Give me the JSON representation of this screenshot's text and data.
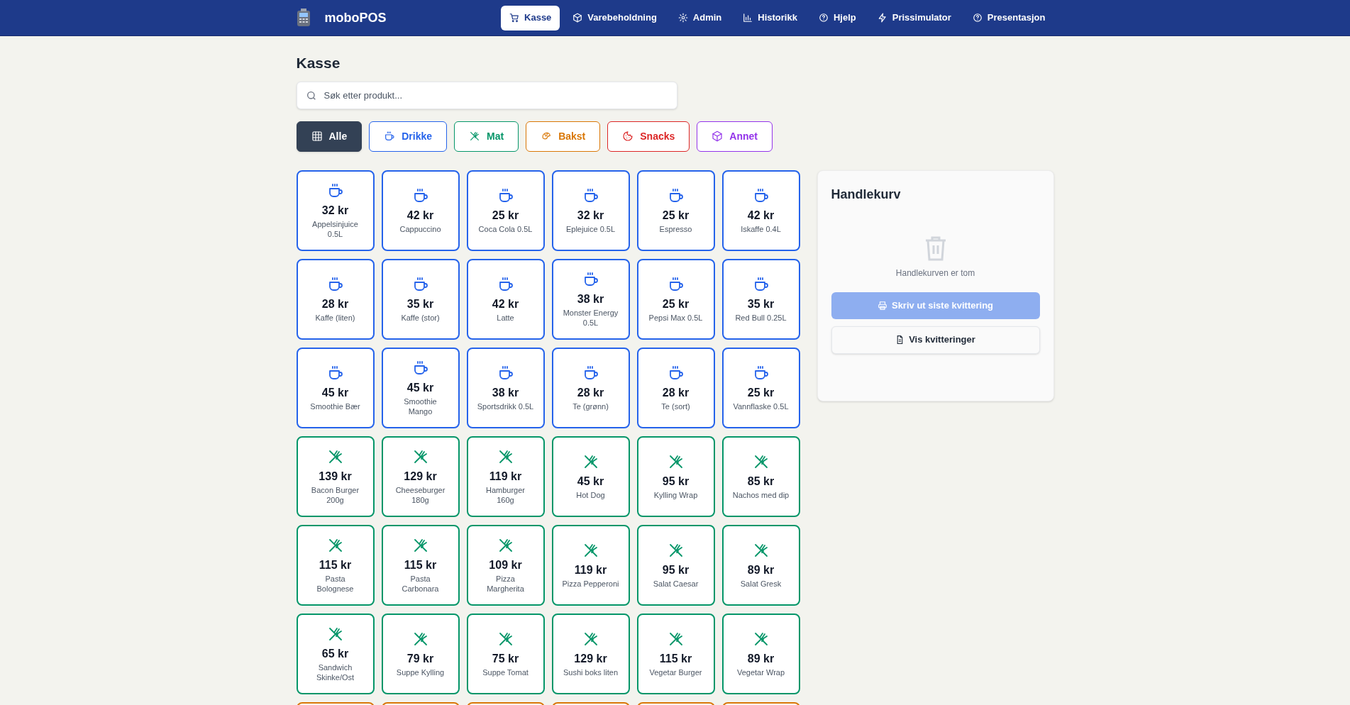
{
  "app": {
    "name": "moboPOS"
  },
  "nav": [
    {
      "label": "Kasse",
      "kind": "cart",
      "selected": true
    },
    {
      "label": "Varebeholdning",
      "kind": "box",
      "selected": false
    },
    {
      "label": "Admin",
      "kind": "gear",
      "selected": false
    },
    {
      "label": "Historikk",
      "kind": "chart",
      "selected": false
    },
    {
      "label": "Hjelp",
      "kind": "help",
      "selected": false
    },
    {
      "label": "Prissimulator",
      "kind": "bolt",
      "selected": false
    },
    {
      "label": "Presentasjon",
      "kind": "help",
      "selected": false
    }
  ],
  "page_title": "Kasse",
  "search": {
    "placeholder": "Søk etter produkt..."
  },
  "categories": [
    {
      "label": "Alle",
      "kind": "alle",
      "selected": true
    },
    {
      "label": "Drikke",
      "kind": "drikke",
      "selected": false
    },
    {
      "label": "Mat",
      "kind": "mat",
      "selected": false
    },
    {
      "label": "Bakst",
      "kind": "bakst",
      "selected": false
    },
    {
      "label": "Snacks",
      "kind": "snacks",
      "selected": false
    },
    {
      "label": "Annet",
      "kind": "annet",
      "selected": false
    }
  ],
  "products": [
    {
      "kind": "drikke",
      "price": "32 kr",
      "name": "Appelsinjuice 0.5L"
    },
    {
      "kind": "drikke",
      "price": "42 kr",
      "name": "Cappuccino"
    },
    {
      "kind": "drikke",
      "price": "25 kr",
      "name": "Coca Cola 0.5L"
    },
    {
      "kind": "drikke",
      "price": "32 kr",
      "name": "Eplejuice 0.5L"
    },
    {
      "kind": "drikke",
      "price": "25 kr",
      "name": "Espresso"
    },
    {
      "kind": "drikke",
      "price": "42 kr",
      "name": "Iskaffe 0.4L"
    },
    {
      "kind": "drikke",
      "price": "28 kr",
      "name": "Kaffe (liten)"
    },
    {
      "kind": "drikke",
      "price": "35 kr",
      "name": "Kaffe (stor)"
    },
    {
      "kind": "drikke",
      "price": "42 kr",
      "name": "Latte"
    },
    {
      "kind": "drikke",
      "price": "38 kr",
      "name": "Monster Energy 0.5L"
    },
    {
      "kind": "drikke",
      "price": "25 kr",
      "name": "Pepsi Max 0.5L"
    },
    {
      "kind": "drikke",
      "price": "35 kr",
      "name": "Red Bull 0.25L"
    },
    {
      "kind": "drikke",
      "price": "45 kr",
      "name": "Smoothie Bær"
    },
    {
      "kind": "drikke",
      "price": "45 kr",
      "name": "Smoothie Mango"
    },
    {
      "kind": "drikke",
      "price": "38 kr",
      "name": "Sportsdrikk 0.5L"
    },
    {
      "kind": "drikke",
      "price": "28 kr",
      "name": "Te (grønn)"
    },
    {
      "kind": "drikke",
      "price": "28 kr",
      "name": "Te (sort)"
    },
    {
      "kind": "drikke",
      "price": "25 kr",
      "name": "Vannflaske 0.5L"
    },
    {
      "kind": "mat",
      "price": "139 kr",
      "name": "Bacon Burger 200g"
    },
    {
      "kind": "mat",
      "price": "129 kr",
      "name": "Cheeseburger 180g"
    },
    {
      "kind": "mat",
      "price": "119 kr",
      "name": "Hamburger 160g"
    },
    {
      "kind": "mat",
      "price": "45 kr",
      "name": "Hot Dog"
    },
    {
      "kind": "mat",
      "price": "95 kr",
      "name": "Kylling Wrap"
    },
    {
      "kind": "mat",
      "price": "85 kr",
      "name": "Nachos med dip"
    },
    {
      "kind": "mat",
      "price": "115 kr",
      "name": "Pasta Bolognese"
    },
    {
      "kind": "mat",
      "price": "115 kr",
      "name": "Pasta Carbonara"
    },
    {
      "kind": "mat",
      "price": "109 kr",
      "name": "Pizza Margherita"
    },
    {
      "kind": "mat",
      "price": "119 kr",
      "name": "Pizza Pepperoni"
    },
    {
      "kind": "mat",
      "price": "95 kr",
      "name": "Salat Caesar"
    },
    {
      "kind": "mat",
      "price": "89 kr",
      "name": "Salat Gresk"
    },
    {
      "kind": "mat",
      "price": "65 kr",
      "name": "Sandwich Skinke/Ost"
    },
    {
      "kind": "mat",
      "price": "79 kr",
      "name": "Suppe Kylling"
    },
    {
      "kind": "mat",
      "price": "75 kr",
      "name": "Suppe Tomat"
    },
    {
      "kind": "mat",
      "price": "129 kr",
      "name": "Sushi boks liten"
    },
    {
      "kind": "mat",
      "price": "115 kr",
      "name": "Vegetar Burger"
    },
    {
      "kind": "mat",
      "price": "89 kr",
      "name": "Vegetar Wrap"
    },
    {
      "kind": "bakst"
    },
    {
      "kind": "bakst"
    },
    {
      "kind": "bakst"
    },
    {
      "kind": "bakst"
    },
    {
      "kind": "bakst"
    },
    {
      "kind": "bakst"
    }
  ],
  "cart": {
    "title": "Handlekurv",
    "empty_text": "Handlekurven er tom",
    "print_button": {
      "label": "Skriv ut siste kvittering",
      "disabled": true
    },
    "receipts_button": {
      "label": "Vis kvitteringer"
    }
  }
}
